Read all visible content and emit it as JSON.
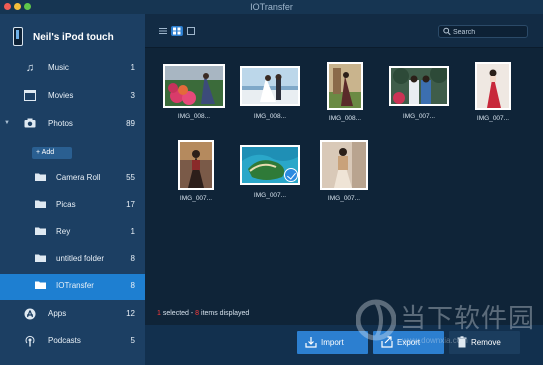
{
  "window": {
    "title": "IOTransfer"
  },
  "device": {
    "name": "Neil's iPod touch"
  },
  "sidebar": {
    "items": [
      {
        "label": "Music",
        "count": "1",
        "icon": "music-note-icon"
      },
      {
        "label": "Movies",
        "count": "3",
        "icon": "film-icon"
      },
      {
        "label": "Photos",
        "count": "89",
        "icon": "camera-icon"
      },
      {
        "label": "Camera Roll",
        "count": "55",
        "icon": "folder-icon"
      },
      {
        "label": "Picas",
        "count": "17",
        "icon": "folder-icon"
      },
      {
        "label": "Rey",
        "count": "1",
        "icon": "folder-icon"
      },
      {
        "label": "untitled folder",
        "count": "8",
        "icon": "folder-icon"
      },
      {
        "label": "IOTransfer",
        "count": "8",
        "icon": "folder-icon"
      },
      {
        "label": "Apps",
        "count": "12",
        "icon": "app-store-icon"
      },
      {
        "label": "Podcasts",
        "count": "5",
        "icon": "podcast-icon"
      }
    ],
    "add_label": "+ Add",
    "active": "IOTransfer"
  },
  "toolbar": {
    "search_placeholder": "Search",
    "view_mode": "grid"
  },
  "photos": [
    {
      "caption": "IMG_008...",
      "selected": false
    },
    {
      "caption": "IMG_008...",
      "selected": false
    },
    {
      "caption": "IMG_008...",
      "selected": false
    },
    {
      "caption": "IMG_007...",
      "selected": false
    },
    {
      "caption": "IMG_007...",
      "selected": false
    },
    {
      "caption": "IMG_007...",
      "selected": false
    },
    {
      "caption": "IMG_007...",
      "selected": true
    },
    {
      "caption": "IMG_007...",
      "selected": false
    }
  ],
  "status": {
    "selected_count": "1",
    "selected_text": " selected - ",
    "displayed_count": "8",
    "displayed_text": " items displayed"
  },
  "actions": {
    "import_label": "Import",
    "export_label": "Export",
    "remove_label": "Remove"
  },
  "watermark": {
    "text": "当下软件园",
    "url": "www.downxia.com"
  },
  "colors": {
    "sidebar_bg": "#1c3f63",
    "main_bg": "#0f2438",
    "accent": "#2c7fd0",
    "active_item": "#1e7fd1",
    "status_red": "#ff3b3b"
  }
}
